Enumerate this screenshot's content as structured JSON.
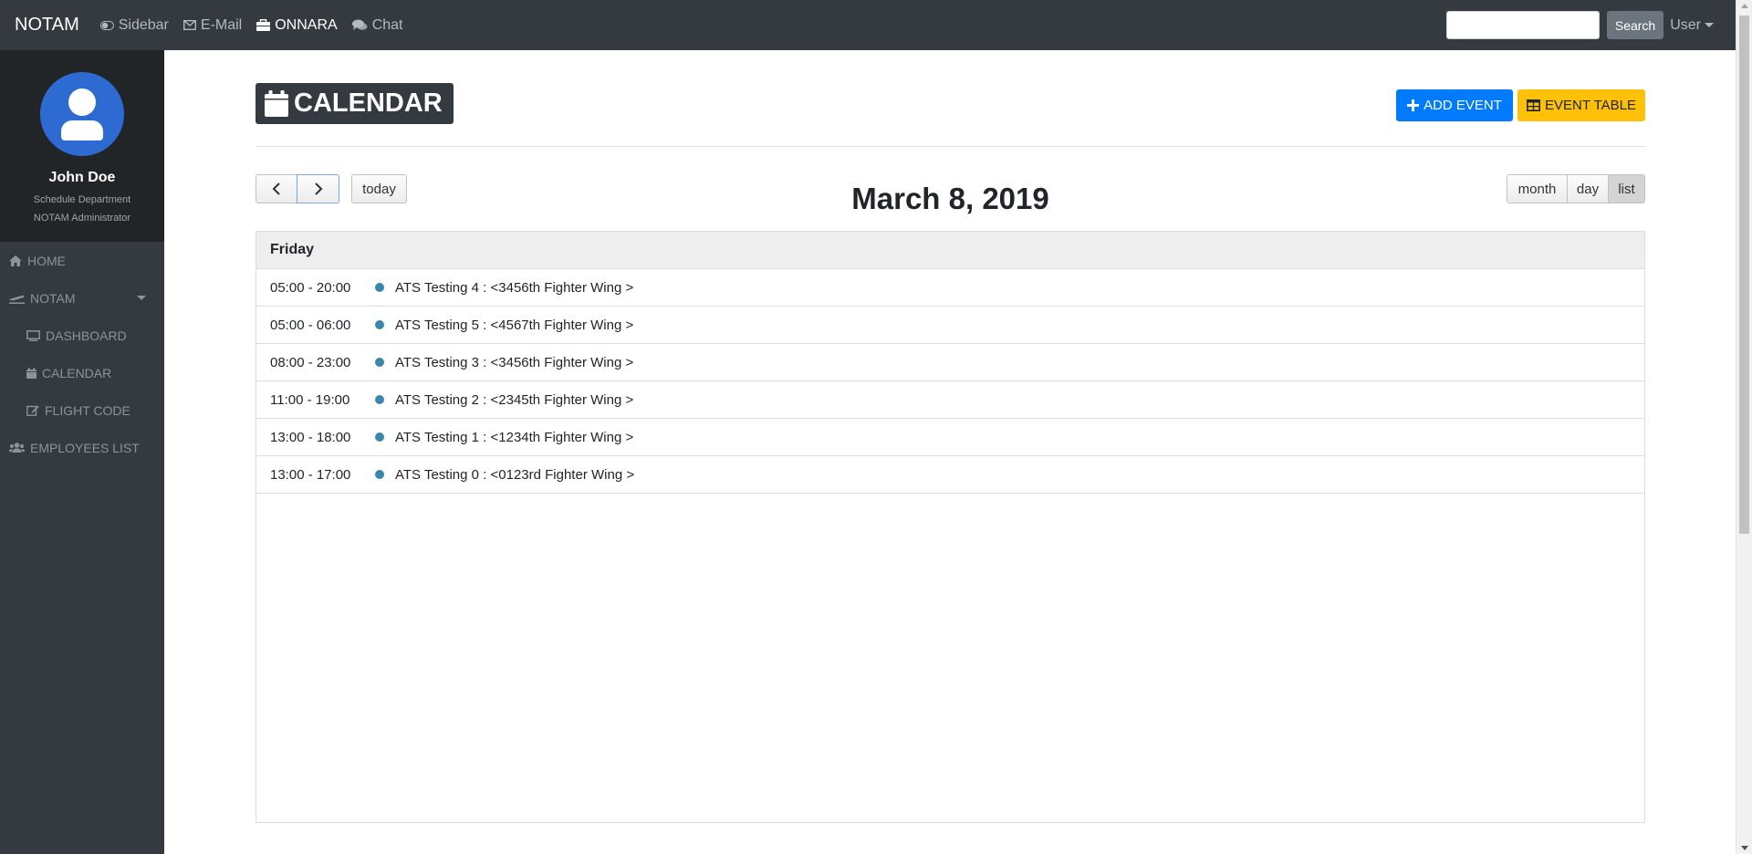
{
  "navbar": {
    "brand": "NOTAM",
    "links": [
      {
        "label": "Sidebar",
        "icon": "toggle-icon"
      },
      {
        "label": "E-Mail",
        "icon": "envelope-icon"
      },
      {
        "label": "ONNARA",
        "icon": "briefcase-icon"
      },
      {
        "label": "Chat",
        "icon": "comments-icon"
      }
    ],
    "search": {
      "value": "",
      "placeholder": "",
      "button_label": "Search"
    },
    "user_label": "User"
  },
  "sidebar": {
    "profile": {
      "name": "John Doe",
      "department": "Schedule Department",
      "role": "NOTAM Administrator"
    },
    "items": [
      {
        "label": "HOME",
        "icon": "home-icon"
      },
      {
        "label": "NOTAM",
        "icon": "plane-icon"
      },
      {
        "label": "DASHBOARD",
        "icon": "desktop-icon"
      },
      {
        "label": "CALENDAR",
        "icon": "calendar-icon"
      },
      {
        "label": "FLIGHT CODE",
        "icon": "edit-icon"
      },
      {
        "label": "EMPLOYEES LIST",
        "icon": "users-icon"
      }
    ]
  },
  "header": {
    "title": "CALENDAR",
    "add_event_label": "ADD EVENT",
    "event_table_label": "EVENT TABLE"
  },
  "calendar": {
    "today_label": "today",
    "title": "March 8, 2019",
    "views": [
      "month",
      "day",
      "list"
    ],
    "active_view": "list",
    "day_heading": "Friday",
    "events": [
      {
        "time": "05:00 - 20:00",
        "title": "ATS Testing 4 : <3456th Fighter Wing >"
      },
      {
        "time": "05:00 - 06:00",
        "title": "ATS Testing 5 : <4567th Fighter Wing >"
      },
      {
        "time": "08:00 - 23:00",
        "title": "ATS Testing 3 : <3456th Fighter Wing >"
      },
      {
        "time": "11:00 - 19:00",
        "title": "ATS Testing 2 : <2345th Fighter Wing >"
      },
      {
        "time": "13:00 - 18:00",
        "title": "ATS Testing 1 : <1234th Fighter Wing >"
      },
      {
        "time": "13:00 - 17:00",
        "title": "ATS Testing 0 : <0123rd Fighter Wing >"
      }
    ]
  },
  "colors": {
    "navbar_bg": "#343a40",
    "primary": "#007bff",
    "warning": "#ffc107",
    "event_dot": "#3a87ad",
    "avatar": "#2d6bd3"
  }
}
